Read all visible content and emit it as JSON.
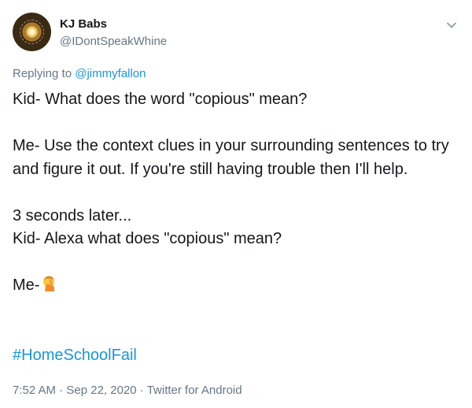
{
  "author": {
    "name": "KJ Babs",
    "handle": "@IDontSpeakWhine",
    "avatar_icon": "dandelion-avatar"
  },
  "reply": {
    "prefix": "Replying to",
    "target": "@jimmyfallon"
  },
  "body": {
    "line1": "Kid- What does the word \"copious\" mean?",
    "line2": "Me- Use the context clues in your surrounding sentences to try and figure it out. If you're still having trouble then I'll help.",
    "line3a": "3 seconds later...",
    "line3b": "Kid- Alexa what does \"copious\" mean?",
    "line4": "Me-",
    "emoji": "face-palm-emoji"
  },
  "hashtag": "#HomeSchoolFail",
  "meta": {
    "time": "7:52 AM",
    "sep1": " · ",
    "date": "Sep 22, 2020",
    "sep2": " · ",
    "source": "Twitter for Android"
  },
  "colors": {
    "text": "#14171a",
    "muted": "#657786",
    "link": "#1b95e0"
  }
}
